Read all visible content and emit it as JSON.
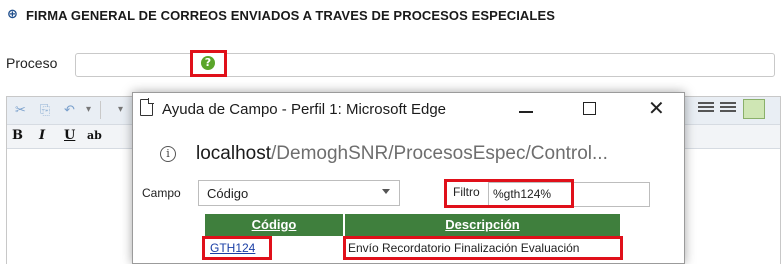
{
  "header": {
    "icon": "info-icon",
    "title": "FIRMA GENERAL DE CORREOS ENVIADOS A TRAVES DE PROCESOS ESPECIALES"
  },
  "form": {
    "proceso_label": "Proceso",
    "proceso_value": "",
    "help_icon": "help-icon"
  },
  "editor": {
    "toolbar": {
      "bold": "B",
      "italic": "I",
      "underline": "U",
      "strike": "ab"
    }
  },
  "popup": {
    "title": "Ayuda de Campo - Perfil 1: Microsoft Edge",
    "address_host": "localhost",
    "address_path": "/DemoghSNR/ProcesosEspec/Control...",
    "campo_label": "Campo",
    "campo_value": "Código",
    "filtro_label": "Filtro",
    "filtro_value": "%gth124%",
    "table": {
      "headers": [
        "Código",
        "Descripción"
      ],
      "rows": [
        [
          "GTH124",
          "Envío Recordatorio Finalización Evaluación"
        ]
      ]
    }
  },
  "colors": {
    "highlight": "#e0101a",
    "table_header": "#3f7f3d",
    "link": "#1a3fa6"
  }
}
